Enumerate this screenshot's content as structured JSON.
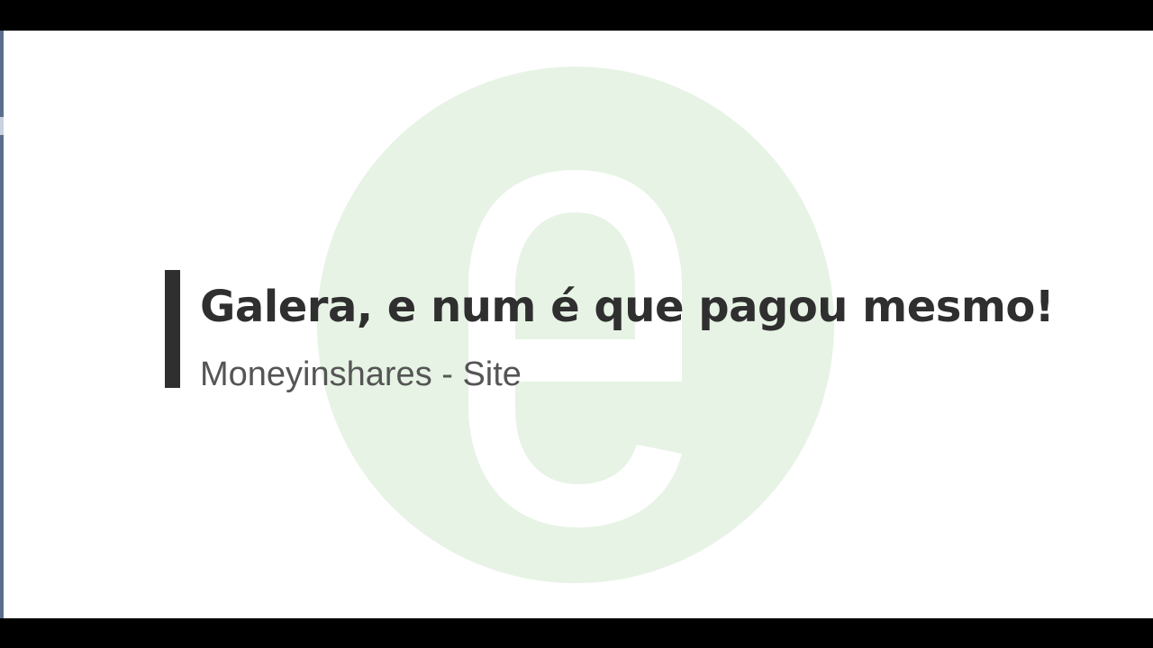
{
  "slide": {
    "headline": "Galera, e num é que pagou mesmo!",
    "subline": "Moneyinshares - Site"
  },
  "colors": {
    "watermark_green": "#e7f3e5",
    "text_dark": "#2f2f2f",
    "text_light": "#555555",
    "accent_bar": "#2f2f2f",
    "background": "#ffffff",
    "letterbox": "#000000"
  },
  "icons": {
    "watermark": "letter-e-logo-icon"
  }
}
